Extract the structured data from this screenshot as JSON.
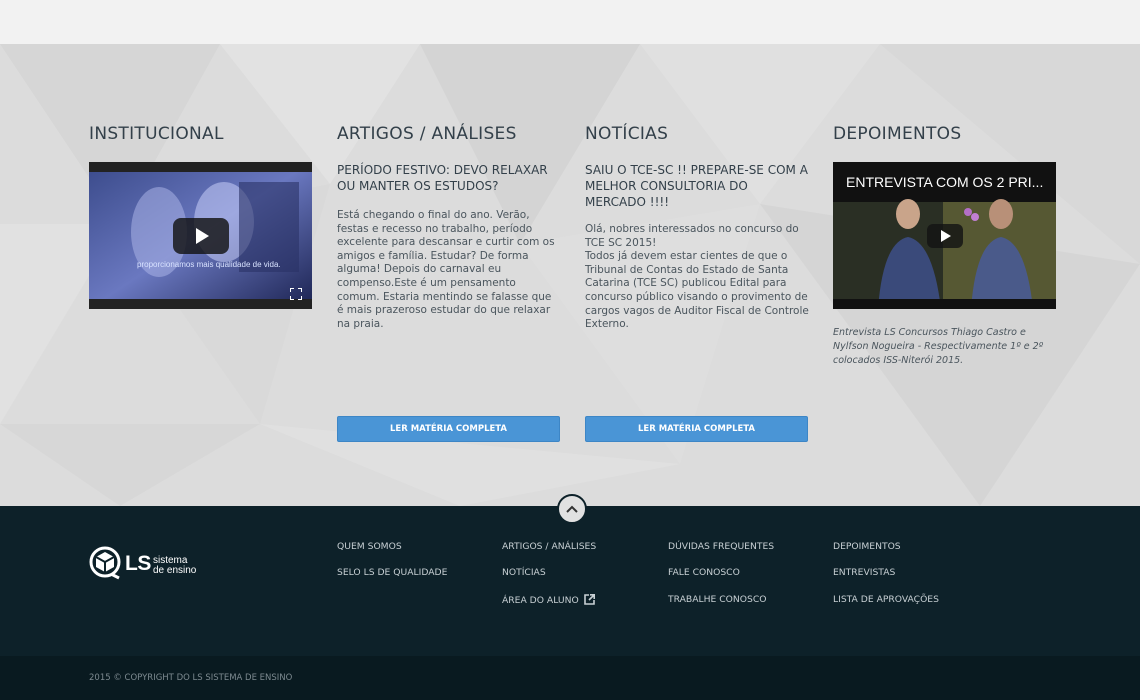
{
  "sections": {
    "institucional": {
      "heading": "INSTITUCIONAL",
      "video_overlay_text": "proporcionamos mais qualidade de vida."
    },
    "artigos": {
      "heading": "ARTIGOS / ANÁLISES",
      "title": "PERÍODO FESTIVO: DEVO RELAXAR OU MANTER OS ESTUDOS?",
      "body": "Está chegando o final do ano. Verão, festas e recesso no trabalho, período excelente para descansar e curtir com os amigos e família. Estudar? De forma alguma! Depois do carnaval eu compenso.Este é um pensamento comum. Estaria mentindo se falasse que é mais prazeroso estudar do que relaxar na praia.",
      "button_label": "LER MATÉRIA COMPLETA"
    },
    "noticias": {
      "heading": "NOTÍCIAS",
      "title": "SAIU O TCE-SC !! PREPARE-SE COM A MELHOR CONSULTORIA DO MERCADO !!!!",
      "body": "Olá, nobres interessados no concurso do TCE SC 2015!\nTodos já devem estar cientes de que o Tribunal de Contas do Estado de Santa Catarina (TCE SC) publicou Edital para concurso público visando o provimento de cargos vagos de Auditor Fiscal de Controle Externo.",
      "button_label": "LER MATÉRIA COMPLETA"
    },
    "depoimentos": {
      "heading": "DEPOIMENTOS",
      "video_title": "ENTREVISTA COM OS 2 PRI...",
      "caption": "Entrevista LS Concursos Thiago Castro e Nylfson Nogueira - Respectivamente 1º e 2º colocados ISS-Niterói 2015."
    }
  },
  "footer": {
    "logo": {
      "mark": "LS",
      "line1": "sistema",
      "line2": "de ensino"
    },
    "columns": [
      [
        "QUEM SOMOS",
        "SELO LS DE QUALIDADE"
      ],
      [
        "ARTIGOS / ANÁLISES",
        "NOTÍCIAS",
        "ÁREA DO ALUNO"
      ],
      [
        "DÚVIDAS FREQUENTES",
        "FALE CONOSCO",
        "TRABALHE CONOSCO"
      ],
      [
        "DEPOIMENTOS",
        "ENTREVISTAS",
        "LISTA DE APROVAÇÕES"
      ]
    ],
    "copyright": "2015 © COPYRIGHT DO LS SISTEMA DE ENSINO"
  },
  "icons": {
    "play": "play-icon",
    "expand": "fullscreen-icon",
    "scroll_top": "chevron-up-icon",
    "external": "external-link-icon",
    "logo": "ls-logo-icon"
  },
  "colors": {
    "button": "#4a95d6",
    "footer_bg": "#0d2129",
    "content_bg": "#dcdcdc"
  }
}
